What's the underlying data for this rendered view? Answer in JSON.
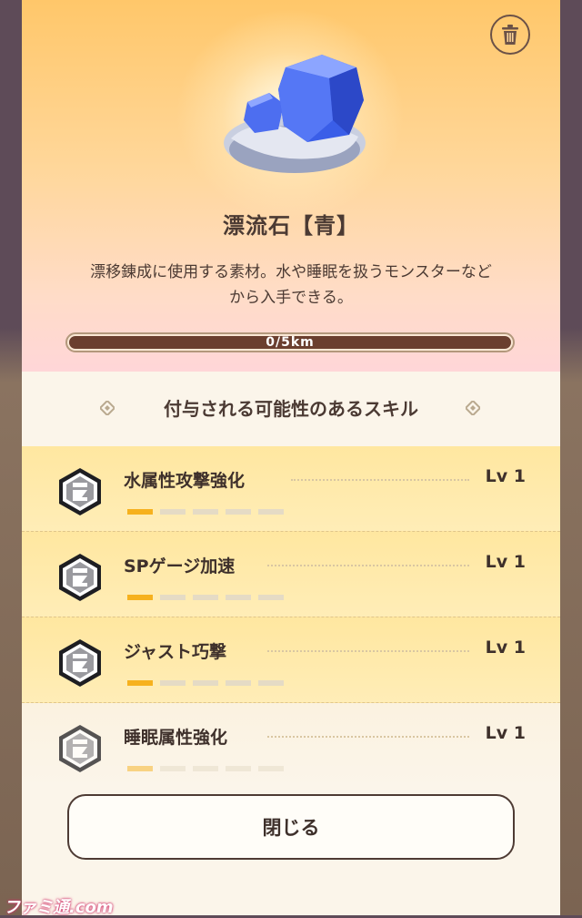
{
  "item": {
    "name": "漂流石【青】",
    "description_line1": "漂移錬成に使用する素材。水や睡眠を扱うモンスターなど",
    "description_line2": "から入手できる。",
    "progress_text": "0/5km",
    "progress_value": 0
  },
  "section": {
    "title": "付与される可能性のあるスキル"
  },
  "skills": [
    {
      "name": "水属性攻撃強化",
      "level": "Lv 1",
      "level_value": 1,
      "level_max": 5
    },
    {
      "name": "SPゲージ加速",
      "level": "Lv 1",
      "level_value": 1,
      "level_max": 5
    },
    {
      "name": "ジャスト巧撃",
      "level": "Lv 1",
      "level_value": 1,
      "level_max": 5
    },
    {
      "name": "睡眠属性強化",
      "level": "Lv 1",
      "level_value": 1,
      "level_max": 5
    }
  ],
  "buttons": {
    "close_label": "閉じる"
  },
  "watermark": "ファミ通.com",
  "icons": {
    "delete": "trash-icon",
    "section": "diamond-icon",
    "skill": "skill-badge-icon"
  },
  "colors": {
    "accent": "#f6b11e",
    "text": "#4b3a33",
    "progress_bar": "#6b3f2f"
  }
}
